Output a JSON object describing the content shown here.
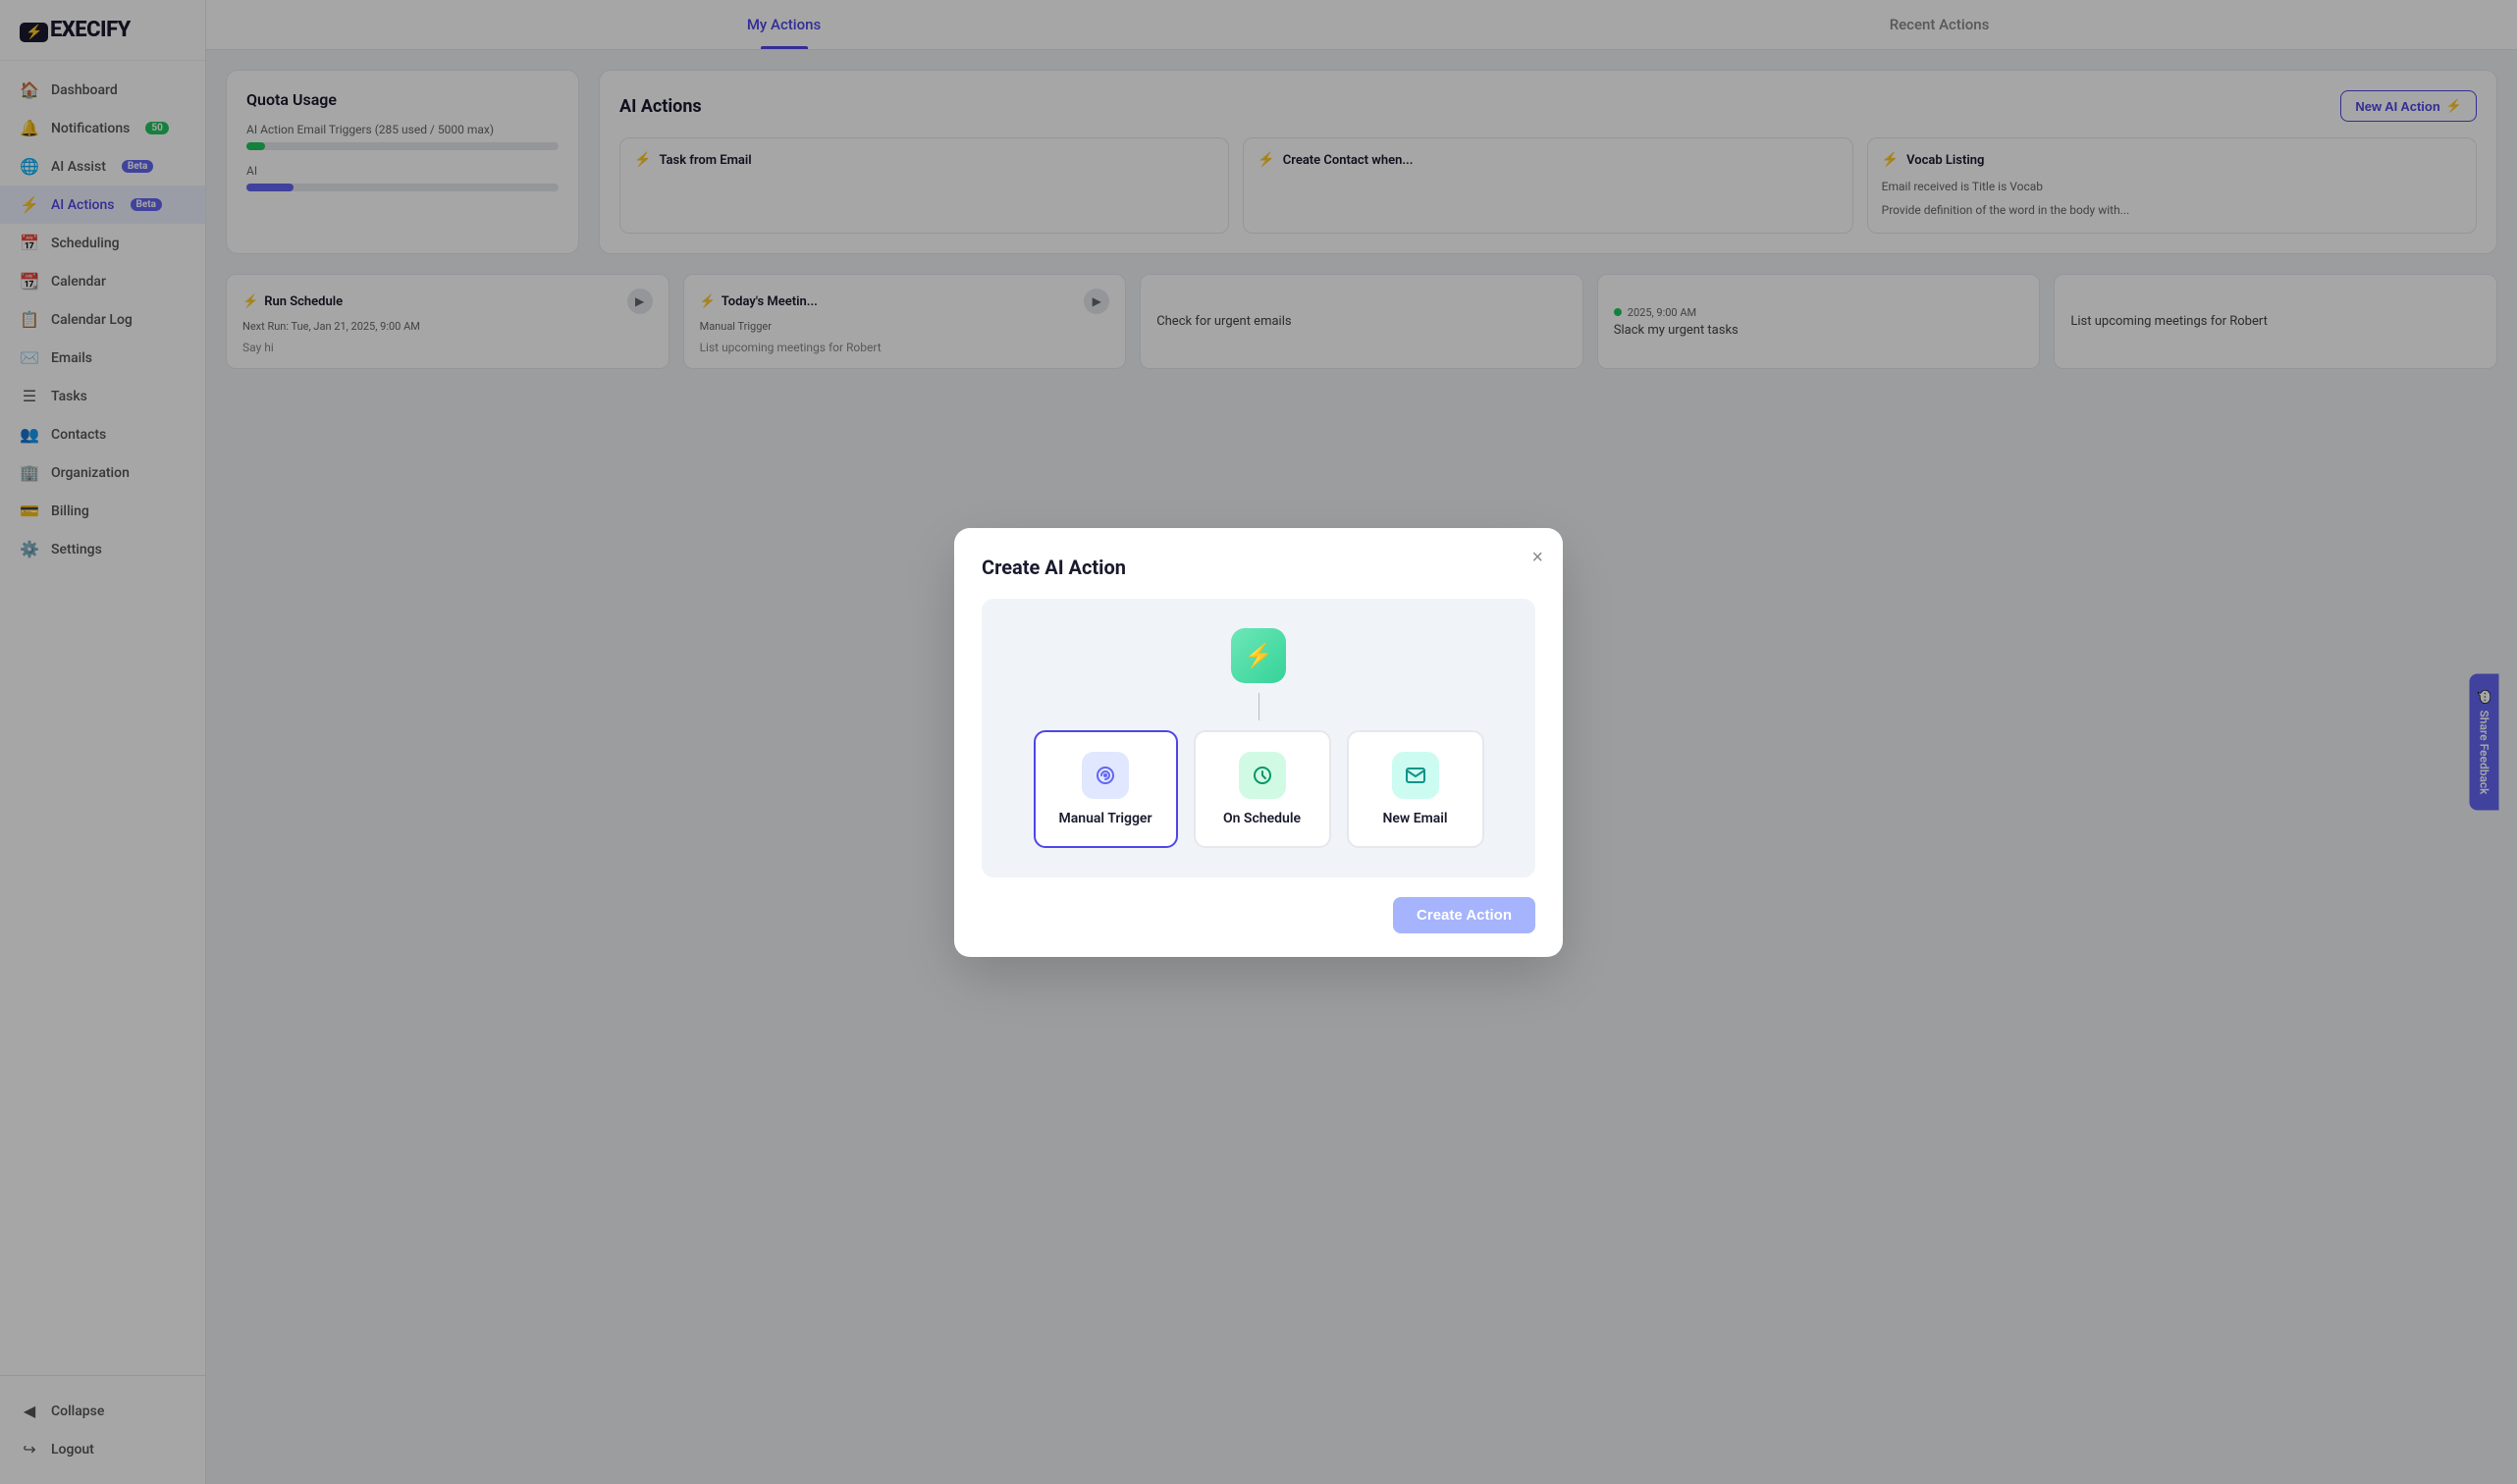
{
  "app": {
    "name": "EXECIFY"
  },
  "sidebar": {
    "items": [
      {
        "id": "dashboard",
        "label": "Dashboard",
        "icon": "🏠",
        "active": false
      },
      {
        "id": "notifications",
        "label": "Notifications",
        "icon": "🔔",
        "active": false,
        "badge": "50",
        "badge_type": "green"
      },
      {
        "id": "ai-assist",
        "label": "AI Assist",
        "icon": "🌐",
        "active": false,
        "badge": "Beta",
        "badge_type": "blue"
      },
      {
        "id": "ai-actions",
        "label": "AI Actions",
        "icon": "⚡",
        "active": true,
        "badge": "Beta",
        "badge_type": "blue"
      },
      {
        "id": "scheduling",
        "label": "Scheduling",
        "icon": "📅",
        "active": false
      },
      {
        "id": "calendar",
        "label": "Calendar",
        "icon": "📆",
        "active": false
      },
      {
        "id": "calendar-log",
        "label": "Calendar Log",
        "icon": "📋",
        "active": false
      },
      {
        "id": "emails",
        "label": "Emails",
        "icon": "✉️",
        "active": false
      },
      {
        "id": "tasks",
        "label": "Tasks",
        "icon": "☰",
        "active": false
      },
      {
        "id": "contacts",
        "label": "Contacts",
        "icon": "👥",
        "active": false
      },
      {
        "id": "organization",
        "label": "Organization",
        "icon": "🏢",
        "active": false
      },
      {
        "id": "billing",
        "label": "Billing",
        "icon": "💳",
        "active": false
      },
      {
        "id": "settings",
        "label": "Settings",
        "icon": "⚙️",
        "active": false
      }
    ],
    "bottom_items": [
      {
        "id": "collapse",
        "label": "Collapse",
        "icon": "◀"
      },
      {
        "id": "logout",
        "label": "Logout",
        "icon": "↪"
      }
    ]
  },
  "tabs": [
    {
      "id": "my-actions",
      "label": "My Actions",
      "active": true
    },
    {
      "id": "recent-actions",
      "label": "Recent Actions",
      "active": false
    }
  ],
  "quota": {
    "title": "Quota Usage",
    "email_triggers_label": "AI Action Email Triggers (285 used / 5000 max)",
    "email_triggers_pct": 6,
    "second_label": "AI",
    "second_pct": 15
  },
  "ai_actions": {
    "title": "AI Actions",
    "new_button": "New AI Action",
    "cards": [
      {
        "id": "task-from-email",
        "label": "Task from Email",
        "description": ""
      },
      {
        "id": "create-contact",
        "label": "Create Contact when...",
        "description": ""
      },
      {
        "id": "vocab-listing",
        "label": "Vocab Listing",
        "description": "Email received is Title is Vocab",
        "extra": "Provide definition of the word in the body with..."
      }
    ]
  },
  "action_cards": [
    {
      "id": "run-schedule",
      "title": "Run Schedule",
      "meta": "Next Run: Tue, Jan 21, 2025, 9:00 AM",
      "description": "Say hi",
      "has_run_btn": true
    },
    {
      "id": "todays-meeting",
      "title": "Today's Meetin...",
      "meta": "Manual Trigger",
      "description": "List upcoming meetings for Robert",
      "has_run_btn": true
    }
  ],
  "bottom_cards": [
    {
      "id": "check-urgent",
      "description": "Check for urgent emails"
    },
    {
      "id": "slack-tasks",
      "description": "Slack my urgent tasks",
      "meta": "2025, 9:00 AM"
    },
    {
      "id": "list-meetings",
      "description": "List upcoming meetings for Robert"
    }
  ],
  "modal": {
    "title": "Create AI Action",
    "close_label": "×",
    "options": [
      {
        "id": "manual-trigger",
        "label": "Manual Trigger",
        "icon_type": "purple",
        "selected": true
      },
      {
        "id": "on-schedule",
        "label": "On Schedule",
        "icon_type": "green",
        "selected": false
      },
      {
        "id": "new-email",
        "label": "New Email",
        "icon_type": "teal",
        "selected": false
      }
    ],
    "create_button": "Create Action"
  },
  "feedback": {
    "label": "Share Feedback"
  }
}
